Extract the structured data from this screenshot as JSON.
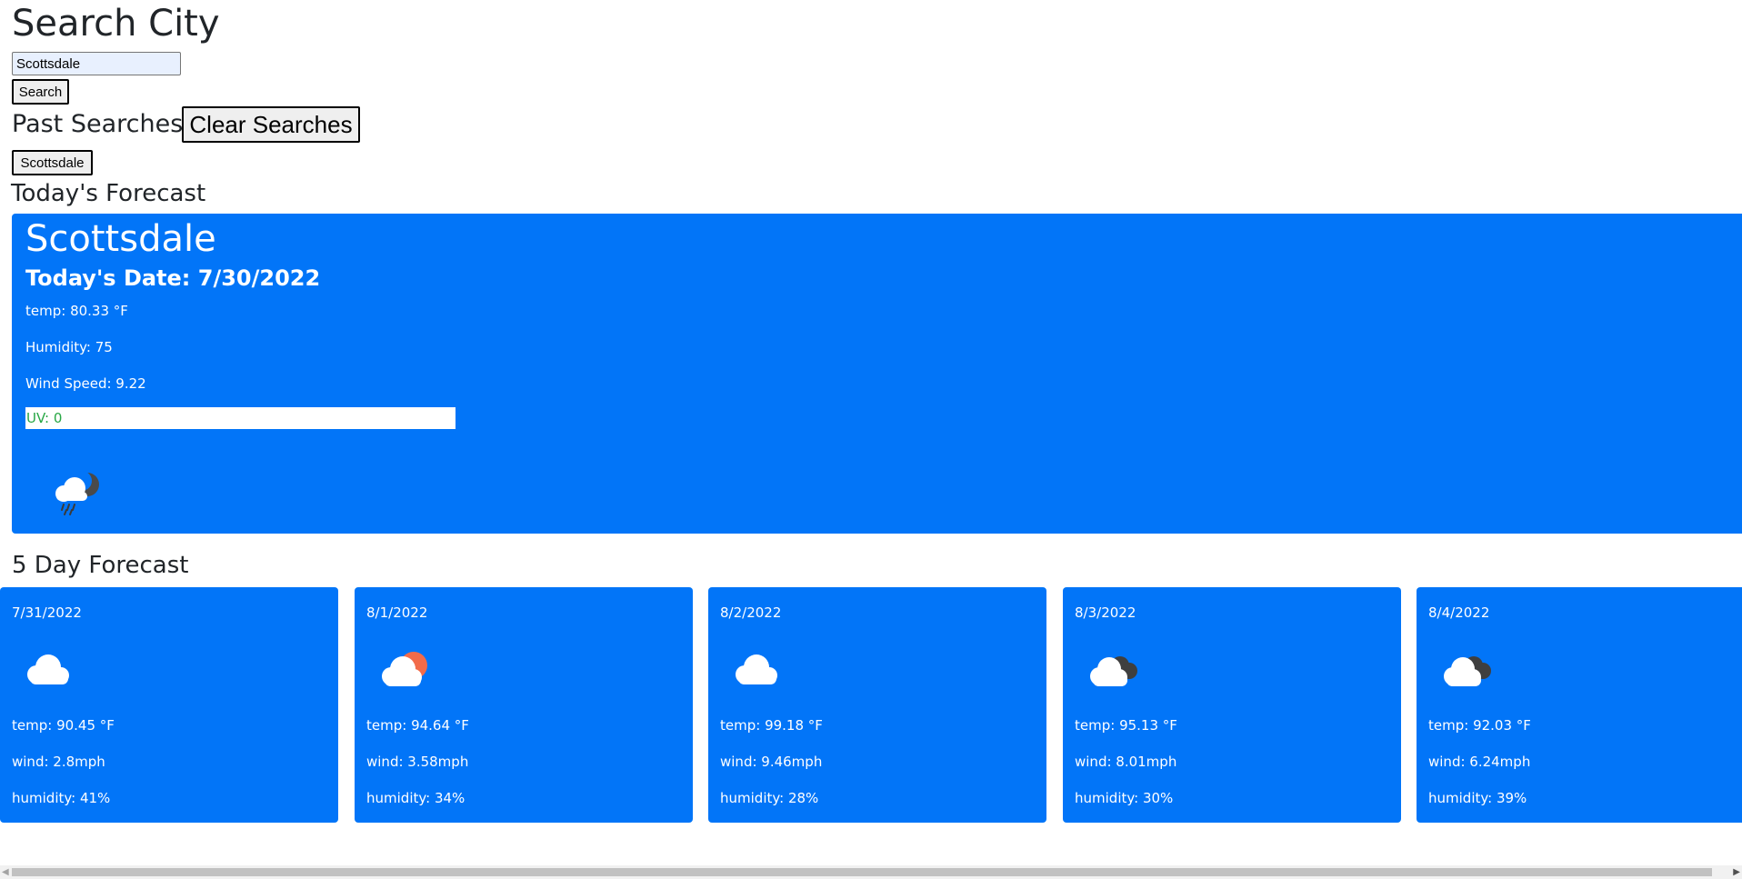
{
  "search": {
    "title": "Search City",
    "input_value": "Scottsdale",
    "button_label": "Search"
  },
  "history": {
    "title": "Past Searches",
    "clear_label": "Clear Searches",
    "items": [
      "Scottsdale"
    ]
  },
  "today": {
    "heading": "Today's Forecast",
    "city": "Scottsdale",
    "date_line": "Today's Date: 7/30/2022",
    "temp_line": "temp: 80.33 °F",
    "humidity_line": "Humidity: 75",
    "wind_line": "Wind Speed: 9.22",
    "uv_line": "UV: 0",
    "uv_color": "#28a745",
    "icon": "cloud-rain-night-icon"
  },
  "forecast": {
    "heading": "5 Day Forecast",
    "days": [
      {
        "date": "7/31/2022",
        "icon": "cloud-icon",
        "temp": "temp: 90.45 °F",
        "wind": "wind: 2.8mph",
        "humidity": "humidity: 41%"
      },
      {
        "date": "8/1/2022",
        "icon": "cloud-sun-icon",
        "temp": "temp: 94.64 °F",
        "wind": "wind: 3.58mph",
        "humidity": "humidity: 34%"
      },
      {
        "date": "8/2/2022",
        "icon": "cloud-icon",
        "temp": "temp: 99.18 °F",
        "wind": "wind: 9.46mph",
        "humidity": "humidity: 28%"
      },
      {
        "date": "8/3/2022",
        "icon": "broken-clouds-icon",
        "temp": "temp: 95.13 °F",
        "wind": "wind: 8.01mph",
        "humidity": "humidity: 30%"
      },
      {
        "date": "8/4/2022",
        "icon": "broken-clouds-icon",
        "temp": "temp: 92.03 °F",
        "wind": "wind: 6.24mph",
        "humidity": "humidity: 39%"
      }
    ]
  },
  "colors": {
    "card_bg": "#0275f8",
    "text_dark": "#212529"
  }
}
